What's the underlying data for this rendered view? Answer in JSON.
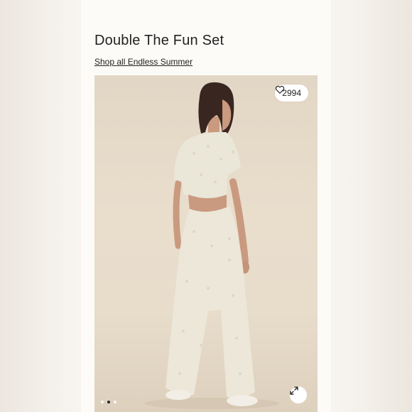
{
  "product": {
    "title": "Double The Fun Set",
    "collection_link": "Shop all Endless Summer"
  },
  "gallery": {
    "like_count": "2994",
    "slide_count": 3,
    "active_slide": 2
  },
  "icons": {
    "heart": "heart-icon",
    "expand": "expand-icon"
  },
  "colors": {
    "page_bg": "#fdfbf8",
    "photo_bg": "#e6dac8",
    "garment": "#eae6d8",
    "hair": "#3a2620"
  }
}
